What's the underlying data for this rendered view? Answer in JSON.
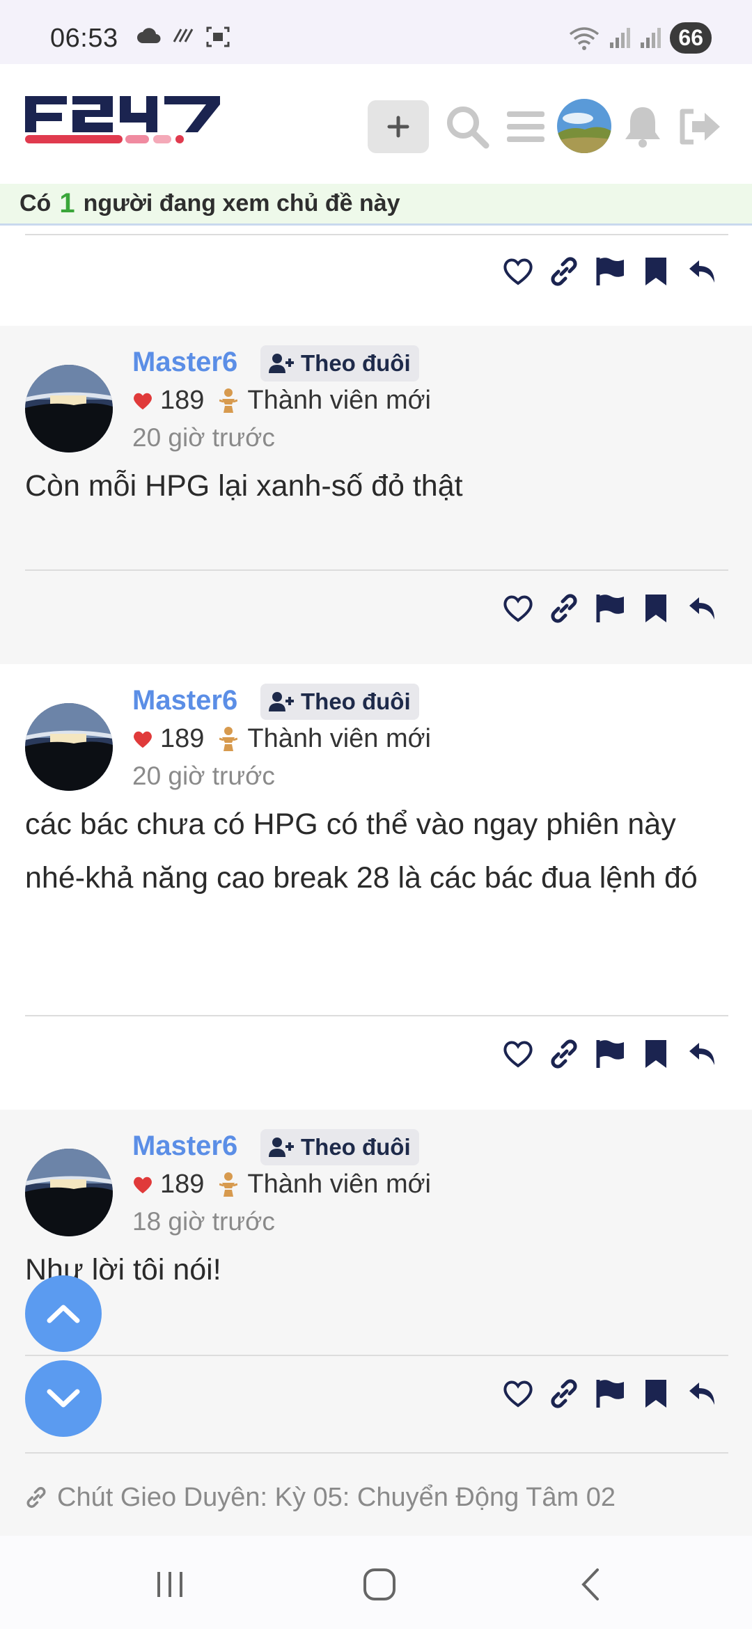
{
  "status_bar": {
    "time": "06:53",
    "battery": "66",
    "icons": [
      "cloud-icon",
      "data-saver-icon",
      "screenshot-icon",
      "wifi-icon",
      "signal-icon",
      "signal-icon"
    ]
  },
  "header": {
    "logo_text": "F247",
    "icons": [
      "plus-icon",
      "search-icon",
      "menu-icon",
      "user-avatar",
      "bell-icon",
      "logout-icon"
    ]
  },
  "viewers": {
    "prefix": "Có",
    "count": "1",
    "suffix": "người đang xem chủ đề này"
  },
  "posts": [
    {
      "author": "Master6",
      "follow_label": "Theo đuôi",
      "likes": "189",
      "role": "Thành viên mới",
      "time": "20 giờ trước",
      "content": "Còn mỗi HPG lại xanh-số đỏ thật"
    },
    {
      "author": "Master6",
      "follow_label": "Theo đuôi",
      "likes": "189",
      "role": "Thành viên mới",
      "time": "20 giờ trước",
      "content": "các bác chưa có HPG có thể vào ngay phiên này nhé-khả năng cao break 28 là các bác đua lệnh đó"
    },
    {
      "author": "Master6",
      "follow_label": "Theo đuôi",
      "likes": "189",
      "role": "Thành viên mới",
      "time": "18 giờ trước",
      "content": "Như lời tôi nói!"
    }
  ],
  "action_icons": [
    "heart-icon",
    "link-icon",
    "flag-icon",
    "bookmark-icon",
    "reply-icon"
  ],
  "related_link": "Chút Gieo Duyên: Kỳ 05: Chuyển Động Tâm 02",
  "colors": {
    "brand_navy": "#1b2450",
    "brand_red": "#e03a4e",
    "name_blue": "#5b8ee6",
    "fab_blue": "#5b9bf0",
    "heart_red": "#e03a3a",
    "viewer_green": "#3aa63a"
  }
}
